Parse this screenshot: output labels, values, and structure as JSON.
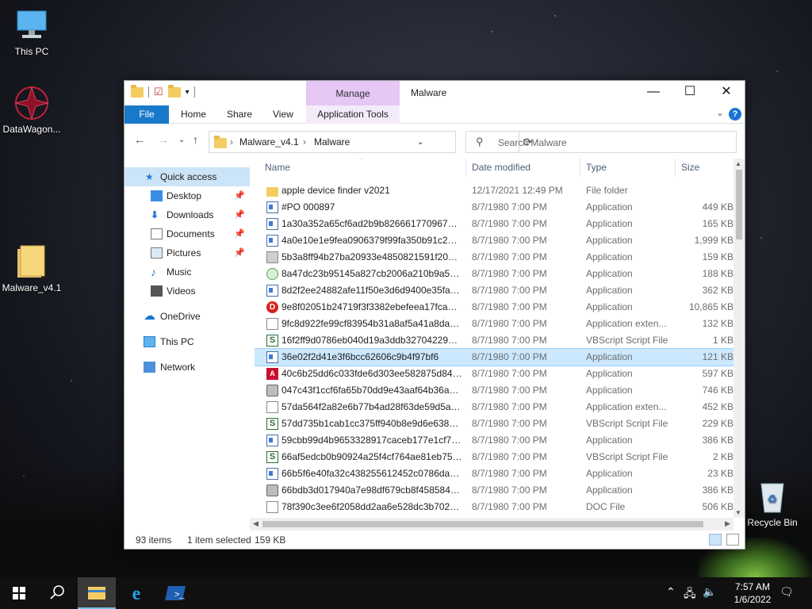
{
  "desktop": {
    "icons": [
      {
        "label": "This PC",
        "icon": "computer-icon"
      },
      {
        "label": "DataWagon...",
        "icon": "datawagon-app-icon"
      },
      {
        "label": "Malware_v4.1",
        "icon": "folder-icon"
      },
      {
        "label": "Recycle Bin",
        "icon": "recycle-bin-icon"
      }
    ]
  },
  "window": {
    "title": "Malware",
    "manage_tab": "Manage",
    "ribbon_tabs": [
      "File",
      "Home",
      "Share",
      "View",
      "Application Tools"
    ],
    "breadcrumb": [
      "Malware_v4.1",
      "Malware"
    ],
    "search_placeholder": "Search Malware"
  },
  "nav_pane": {
    "items": [
      {
        "label": "Quick access",
        "icon": "star-icon",
        "selected": true
      },
      {
        "label": "Desktop",
        "icon": "desktop-icon",
        "pinned": true
      },
      {
        "label": "Downloads",
        "icon": "download-icon",
        "pinned": true
      },
      {
        "label": "Documents",
        "icon": "documents-icon",
        "pinned": true
      },
      {
        "label": "Pictures",
        "icon": "pictures-icon",
        "pinned": true
      },
      {
        "label": "Music",
        "icon": "music-icon"
      },
      {
        "label": "Videos",
        "icon": "videos-icon"
      },
      {
        "label": "OneDrive",
        "icon": "onedrive-icon"
      },
      {
        "label": "This PC",
        "icon": "computer-icon"
      },
      {
        "label": "Network",
        "icon": "network-icon"
      }
    ]
  },
  "columns": [
    "Name",
    "Date modified",
    "Type",
    "Size"
  ],
  "files": [
    {
      "name": "apple device finder v2021",
      "date": "12/17/2021 12:49 PM",
      "type": "File folder",
      "size": "",
      "icon": "folder"
    },
    {
      "name": "#PO 000897",
      "date": "8/7/1980 7:00 PM",
      "type": "Application",
      "size": "449 KB",
      "icon": "app"
    },
    {
      "name": "1a30a352a65cf6ad2b9b8266617709672c77...",
      "date": "8/7/1980 7:00 PM",
      "type": "Application",
      "size": "165 KB",
      "icon": "app"
    },
    {
      "name": "4a0e10e1e9fea0906379f99fa350b91c2af37...",
      "date": "8/7/1980 7:00 PM",
      "type": "Application",
      "size": "1,999 KB",
      "icon": "app"
    },
    {
      "name": "5b3a8ff94b27ba20933e4850821591f20b6c...",
      "date": "8/7/1980 7:00 PM",
      "type": "Application",
      "size": "159 KB",
      "icon": "gray"
    },
    {
      "name": "8a47dc23b95145a827cb2006a210b9a59bb...",
      "date": "8/7/1980 7:00 PM",
      "type": "Application",
      "size": "188 KB",
      "icon": "green"
    },
    {
      "name": "8d2f2ee24882afe11f50e3d6d9400e35fa667...",
      "date": "8/7/1980 7:00 PM",
      "type": "Application",
      "size": "362 KB",
      "icon": "app"
    },
    {
      "name": "9e8f02051b24719f3f3382ebefeea17fcadf9...",
      "date": "8/7/1980 7:00 PM",
      "type": "Application",
      "size": "10,865 KB",
      "icon": "red"
    },
    {
      "name": "9fc8d922fe99cf83954b31a8af5a41a8dac0e...",
      "date": "8/7/1980 7:00 PM",
      "type": "Application exten...",
      "size": "132 KB",
      "icon": "doc"
    },
    {
      "name": "16f2ff9d0786eb040d19a3ddb32704229027...",
      "date": "8/7/1980 7:00 PM",
      "type": "VBScript Script File",
      "size": "1 KB",
      "icon": "script"
    },
    {
      "name": "36e02f2d41e3f6bcc62606c9b4f97bf6",
      "date": "8/7/1980 7:00 PM",
      "type": "Application",
      "size": "121 KB",
      "icon": "app",
      "selected": true
    },
    {
      "name": "40c6b25dd6c033fde6d303ee582875d841a...",
      "date": "8/7/1980 7:00 PM",
      "type": "Application",
      "size": "597 KB",
      "icon": "pdf"
    },
    {
      "name": "047c43f1ccf6fa65b70dd9e43aaf64b36a1e...",
      "date": "8/7/1980 7:00 PM",
      "type": "Application",
      "size": "746 KB",
      "icon": "drive"
    },
    {
      "name": "57da564f2a82e6b77b4ad28f63de59d5af6b...",
      "date": "8/7/1980 7:00 PM",
      "type": "Application exten...",
      "size": "452 KB",
      "icon": "doc"
    },
    {
      "name": "57dd735b1cab1cc375ff940b8e9d6e63846...",
      "date": "8/7/1980 7:00 PM",
      "type": "VBScript Script File",
      "size": "229 KB",
      "icon": "script"
    },
    {
      "name": "59cbb99d4b9653328917caceb177e1cf7dd...",
      "date": "8/7/1980 7:00 PM",
      "type": "Application",
      "size": "386 KB",
      "icon": "app"
    },
    {
      "name": "66af5edcb0b90924a25f4cf764ae81eb754b...",
      "date": "8/7/1980 7:00 PM",
      "type": "VBScript Script File",
      "size": "2 KB",
      "icon": "script"
    },
    {
      "name": "66b5f6e40fa32c438255612452c0786dacf5...",
      "date": "8/7/1980 7:00 PM",
      "type": "Application",
      "size": "23 KB",
      "icon": "app"
    },
    {
      "name": "66bdb3d017940a7e98df679cb8f45858467...",
      "date": "8/7/1980 7:00 PM",
      "type": "Application",
      "size": "386 KB",
      "icon": "drive"
    },
    {
      "name": "78f390c3ee6f2058dd2aa6e528dc3b702492...",
      "date": "8/7/1980 7:00 PM",
      "type": "DOC File",
      "size": "506 KB",
      "icon": "doc"
    }
  ],
  "status": {
    "item_count": "93 items",
    "selection": "1 item selected",
    "selection_size": "159 KB"
  },
  "taskbar": {
    "pinned": [
      "start-icon",
      "search-icon",
      "file-explorer-icon",
      "internet-explorer-icon",
      "powershell-icon"
    ],
    "time": "7:57 AM",
    "date": "1/6/2022"
  },
  "colors": {
    "accent": "#1979ca",
    "selection": "#cce8ff",
    "manage_tab": "#e5c8f5"
  }
}
